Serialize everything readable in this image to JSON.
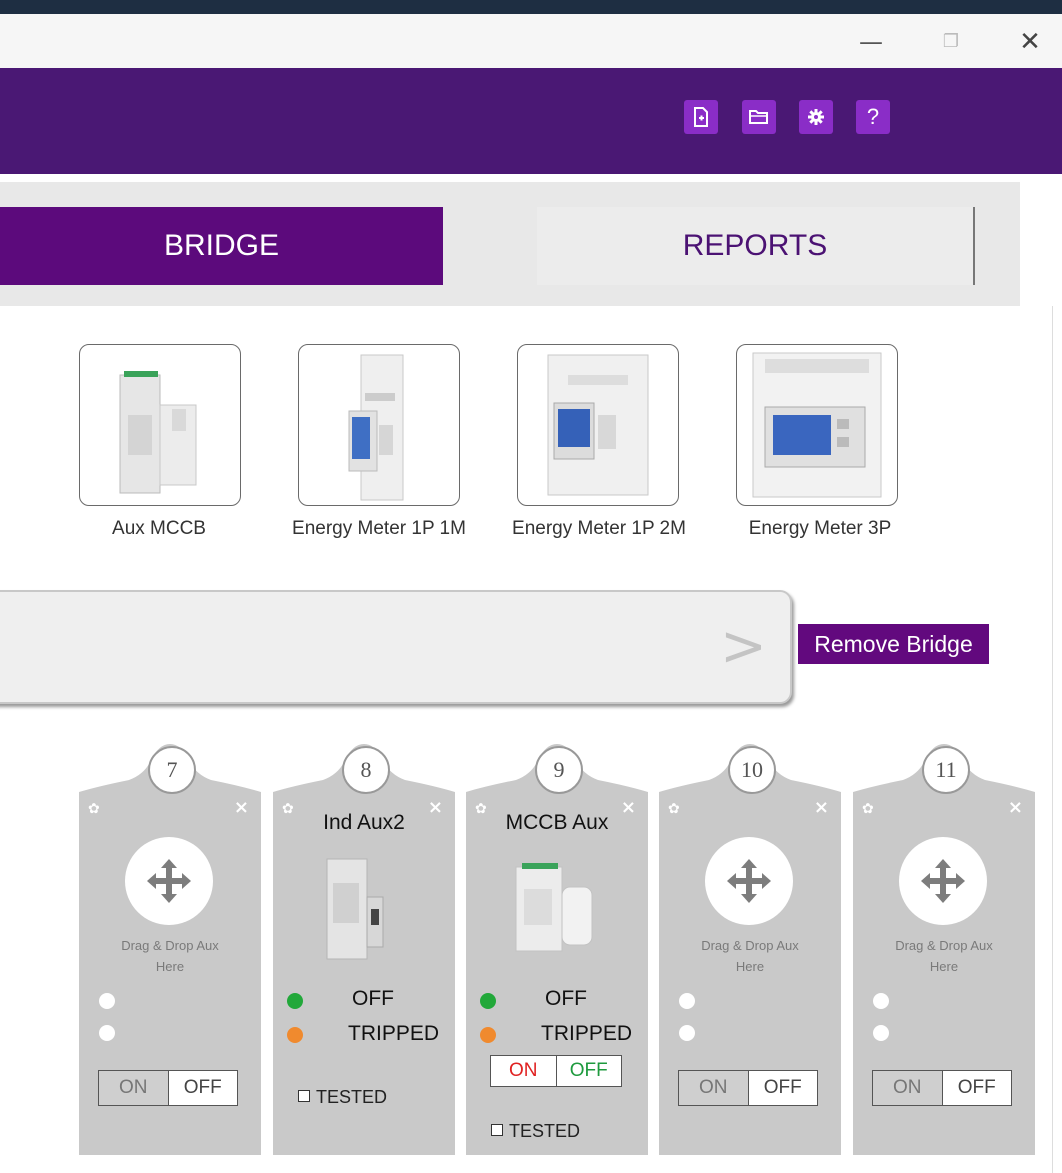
{
  "window": {
    "minimize_glyph": "—",
    "maximize_glyph": "❐",
    "close_glyph": "✕"
  },
  "header": {
    "buttons": [
      {
        "name": "new-file-icon"
      },
      {
        "name": "open-folder-icon"
      },
      {
        "name": "settings-icon"
      },
      {
        "name": "help-icon",
        "glyph": "?"
      }
    ],
    "color": "#4a1874",
    "button_color": "#8a2dc7"
  },
  "tabs": {
    "bridge": "BRIDGE",
    "reports": "REPORTS",
    "active_color": "#5c0a7c"
  },
  "devices": [
    {
      "label": "Aux MCCB",
      "icon": "aux-mccb-device"
    },
    {
      "label": "Energy Meter 1P 1M",
      "icon": "energy-meter-1p-1m-device"
    },
    {
      "label": "Energy Meter 1P 2M",
      "icon": "energy-meter-1p-2m-device"
    },
    {
      "label": "Energy Meter 3P",
      "icon": "energy-meter-3p-device"
    }
  ],
  "bridge_bar": {
    "next_glyph": ">",
    "remove_label": "Remove Bridge"
  },
  "slots": [
    {
      "number": "7",
      "empty": true,
      "drag_text_1": "Drag & Drop Aux",
      "drag_text_2": "Here",
      "on": "ON",
      "off": "OFF"
    },
    {
      "number": "8",
      "empty": false,
      "title": "Ind Aux2",
      "status_1": "OFF",
      "status_2": "TRIPPED",
      "tested": "TESTED"
    },
    {
      "number": "9",
      "empty": false,
      "title": "MCCB Aux",
      "status_1": "OFF",
      "status_2": "TRIPPED",
      "tested": "TESTED",
      "on": "ON",
      "off": "OFF"
    },
    {
      "number": "10",
      "empty": true,
      "drag_text_1": "Drag & Drop Aux",
      "drag_text_2": "Here",
      "on": "ON",
      "off": "OFF"
    },
    {
      "number": "11",
      "empty": true,
      "drag_text_1": "Drag & Drop Aux",
      "drag_text_2": "Here",
      "on": "ON",
      "off": "OFF"
    }
  ],
  "colors": {
    "status_off_dot": "#22a83a",
    "status_tripped_dot": "#f08a2e",
    "slot_bg": "#c9c9c9"
  }
}
